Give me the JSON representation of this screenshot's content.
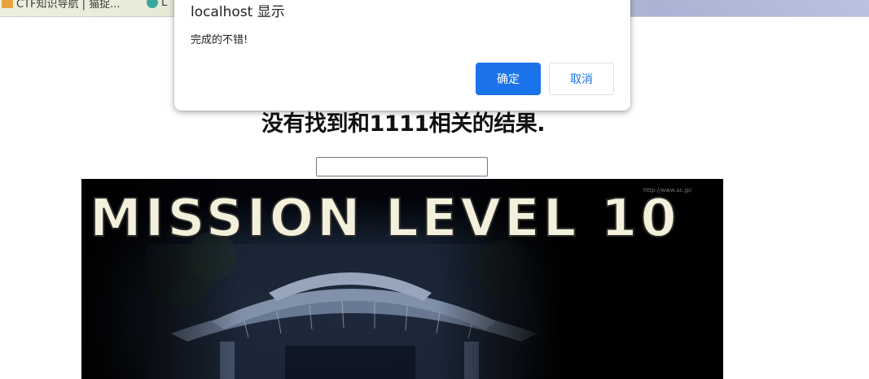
{
  "browser": {
    "bookmarks": [
      {
        "label": "CTF知识导航 | 猫捉...",
        "icon": "bookmark-favicon-icon"
      },
      {
        "label": "L",
        "icon": "globe-icon"
      }
    ]
  },
  "dialog": {
    "title": "localhost 显示",
    "message": "完成的不错!",
    "ok_label": "确定",
    "cancel_label": "取消",
    "accent_color": "#1a73e8"
  },
  "page": {
    "heading": "没有找到和1111相关的结果.",
    "search_value": "",
    "banner": {
      "title_text": "MISSION LEVEL 10",
      "watermark": "http://www.ac.jp/"
    }
  }
}
